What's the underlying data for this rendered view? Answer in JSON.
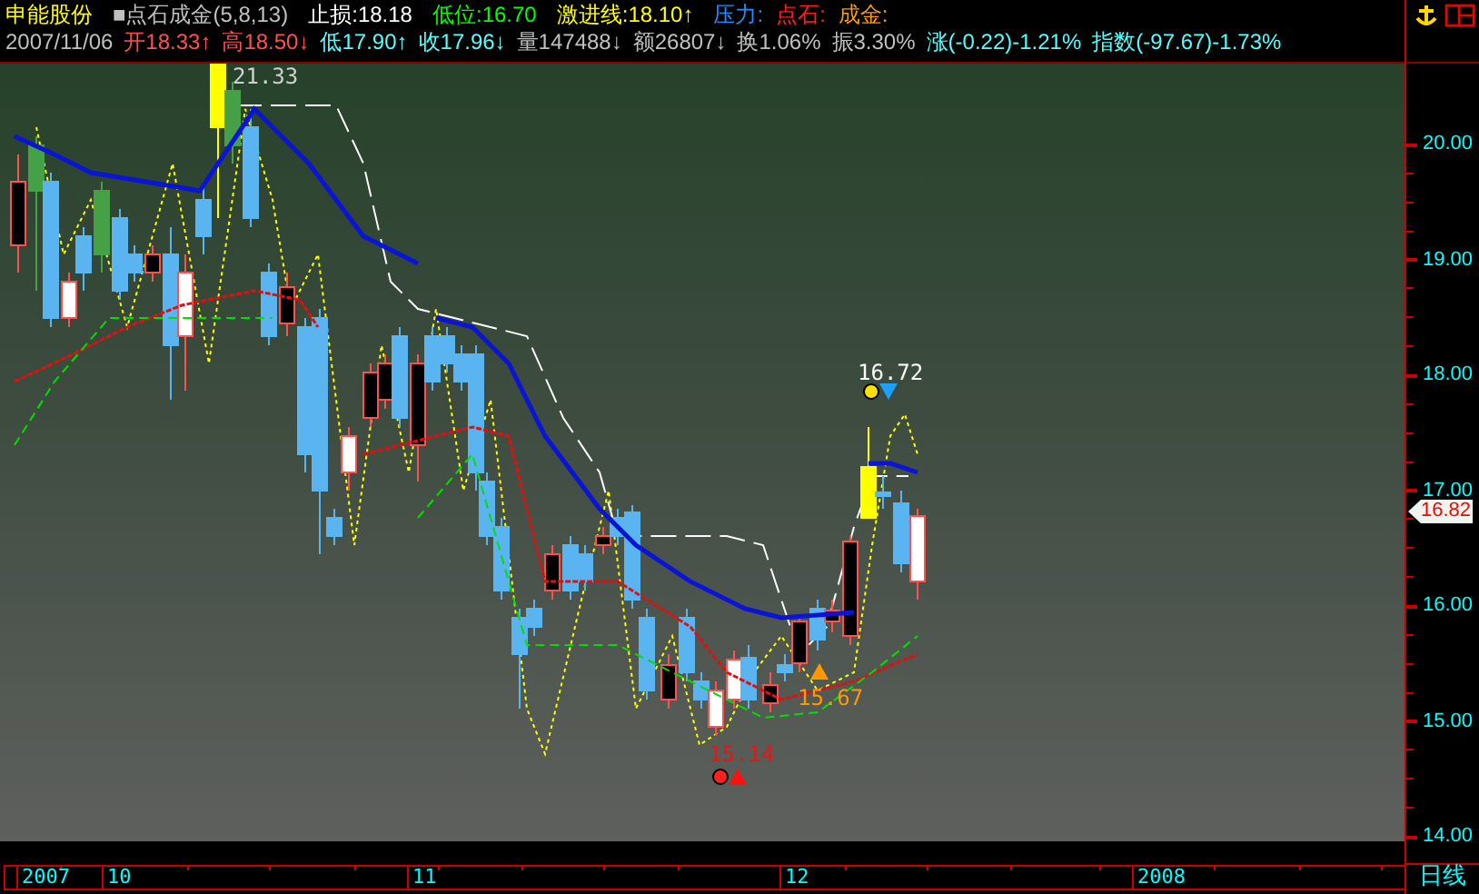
{
  "header": {
    "line_1": [
      {
        "text": "申能股份",
        "color": "#ffff00"
      },
      {
        "text": "■点石成金(5,8,13)",
        "color": "#c0c0c0"
      },
      {
        "text": "止损:18.18",
        "color": "#ffffff"
      },
      {
        "text": "低位:16.70",
        "color": "#00ff00"
      },
      {
        "text": "激进线:18.10↑",
        "color": "#ffff00"
      },
      {
        "text": "压力:",
        "color": "#1e90ff"
      },
      {
        "text": "点石:",
        "color": "#ff2020"
      },
      {
        "text": "成金:",
        "color": "#ff9900"
      }
    ],
    "line_2": [
      {
        "text": "2007/11/06",
        "color": "#c0c0c0"
      },
      {
        "text": "开18.33↑",
        "color": "#ff5050"
      },
      {
        "text": "高18.50↓",
        "color": "#ff5050"
      },
      {
        "text": "低17.90↑",
        "color": "#55ffff"
      },
      {
        "text": "收17.96↓",
        "color": "#55ffff"
      },
      {
        "text": "量147488↓",
        "color": "#c0c0c0"
      },
      {
        "text": "额26807↓",
        "color": "#c0c0c0"
      },
      {
        "text": "换1.06%",
        "color": "#c0c0c0"
      },
      {
        "text": "振3.30%",
        "color": "#c0c0c0"
      },
      {
        "text": "涨(-0.22)-1.21%",
        "color": "#55ffff"
      },
      {
        "text": "指数(-97.67)-1.73%",
        "color": "#55ffff"
      }
    ]
  },
  "chart": {
    "markers": [
      {
        "kind": "high",
        "text": "21.33"
      },
      {
        "kind": "signal_top",
        "text": "16.72"
      },
      {
        "kind": "target",
        "text": "15.67"
      },
      {
        "kind": "signal_bottom",
        "text": "15.14"
      }
    ]
  },
  "price_axis": {
    "ticks": [
      "20.00",
      "19.00",
      "18.00",
      "17.00",
      "16.00",
      "15.00",
      "14.00"
    ],
    "current_price": "16.82"
  },
  "date_axis": {
    "labels": [
      "2007",
      "10",
      "11",
      "12",
      "2008"
    ]
  },
  "period": "日线"
}
